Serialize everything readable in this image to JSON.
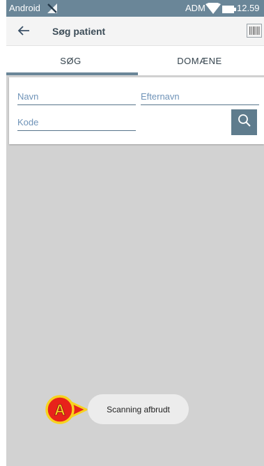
{
  "status_bar": {
    "carrier": "Android",
    "operator": "ADM",
    "time": "12.59",
    "icons": [
      "no-sim-icon",
      "wifi-icon",
      "battery-icon"
    ]
  },
  "app_bar": {
    "title": "Søg patient",
    "back_icon": "arrow-left-icon",
    "scan_icon": "barcode-scan-icon"
  },
  "tabs": [
    {
      "label": "SØG",
      "active": true
    },
    {
      "label": "DOMÆNE",
      "active": false
    }
  ],
  "search_form": {
    "first_name_placeholder": "Navn",
    "last_name_placeholder": "Efternavn",
    "code_placeholder": "Kode",
    "search_icon": "magnifier-icon"
  },
  "toast": {
    "message": "Scanning afbrudt"
  },
  "callout": {
    "letter": "A"
  },
  "colors": {
    "primary": "#6a8698",
    "background": "#d2d2d2",
    "placeholder": "#6f93b8",
    "callout_fill": "#e8221b",
    "callout_ring": "#f7d21f"
  }
}
